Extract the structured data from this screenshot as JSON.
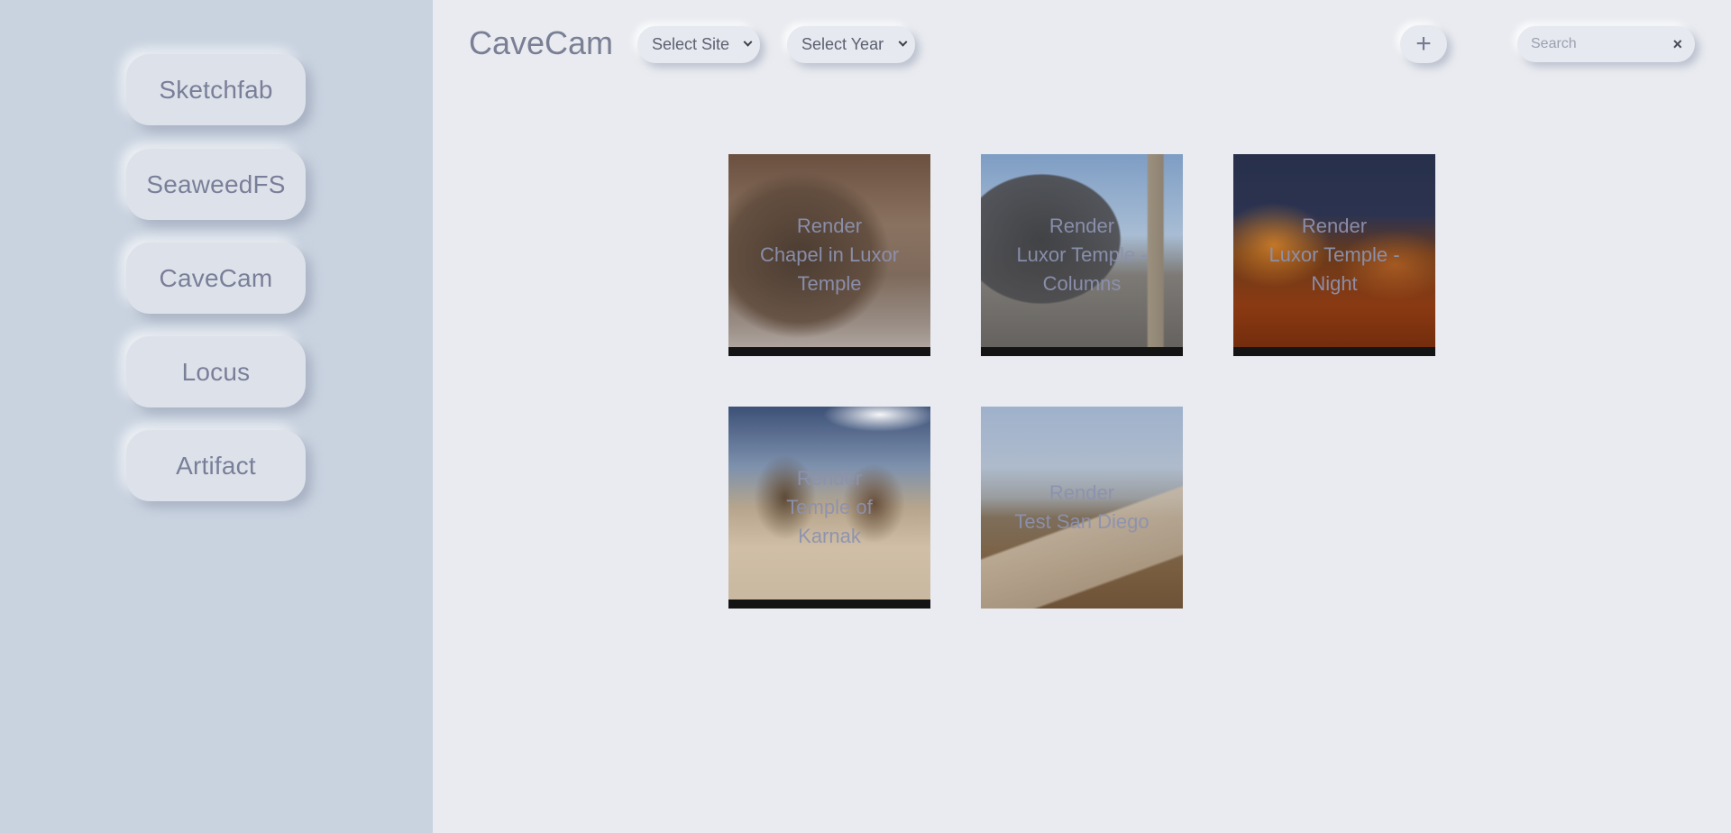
{
  "sidebar": {
    "items": [
      {
        "label": "Sketchfab"
      },
      {
        "label": "SeaweedFS"
      },
      {
        "label": "CaveCam"
      },
      {
        "label": "Locus"
      },
      {
        "label": "Artifact"
      }
    ]
  },
  "header": {
    "title": "CaveCam",
    "site_select": "Select Site",
    "year_select": "Select Year",
    "add_icon": "+",
    "search_placeholder": "Search",
    "clear_icon": "×"
  },
  "gallery": {
    "tiles": [
      {
        "line1": "Render",
        "line2": "Chapel in Luxor",
        "line3": "Temple"
      },
      {
        "line1": "Render",
        "line2": "Luxor Temple -",
        "line3": "Columns"
      },
      {
        "line1": "Render",
        "line2": "Luxor Temple -",
        "line3": "Night"
      },
      {
        "line1": "Render",
        "line2": "Temple of",
        "line3": "Karnak"
      },
      {
        "line1": "Render",
        "line2": "Test San Diego",
        "line3": ""
      }
    ]
  }
}
